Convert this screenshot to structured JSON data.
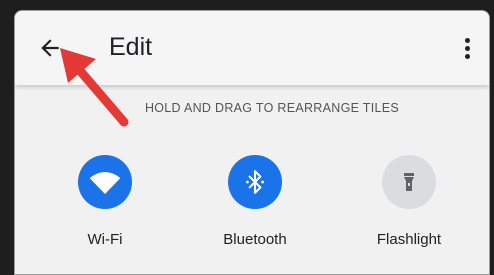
{
  "header": {
    "title": "Edit",
    "back_icon": "arrow-left-icon",
    "menu_icon": "more-vert-icon"
  },
  "hint": "HOLD AND DRAG TO REARRANGE TILES",
  "tiles": [
    {
      "label": "Wi-Fi",
      "icon": "wifi-icon",
      "active": true
    },
    {
      "label": "Bluetooth",
      "icon": "bluetooth-icon",
      "active": true
    },
    {
      "label": "Flashlight",
      "icon": "flashlight-icon",
      "active": false
    }
  ],
  "colors": {
    "accent": "#1a73e8",
    "inactive_tile": "#dadce0",
    "annotation_arrow": "#e53935"
  }
}
